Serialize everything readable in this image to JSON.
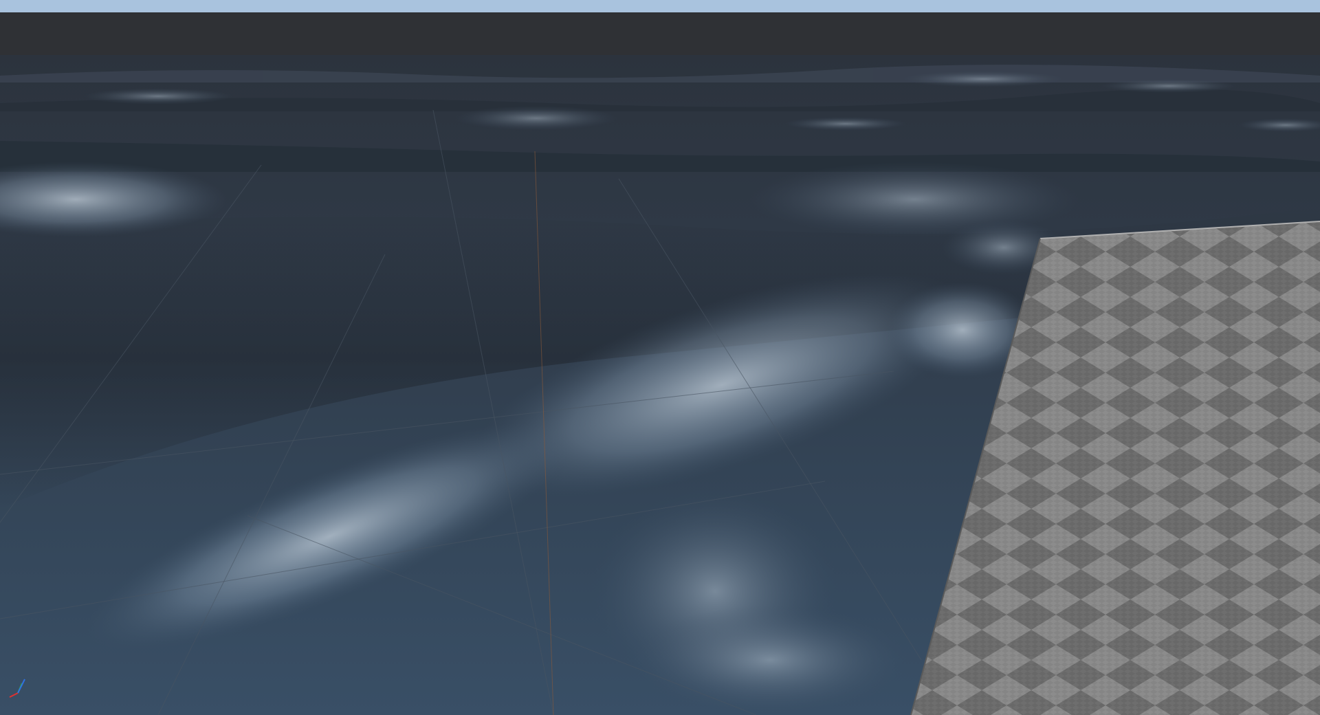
{
  "viewport": {
    "description_label": "",
    "colors": {
      "sky": "#a9c3de",
      "far_band": "#2f3135",
      "water_far": "#2c3440",
      "water_mid": "#324152",
      "water_near": "#37506a",
      "foam": "#b8c7d6",
      "grid_line": "#4a5563",
      "checker_light": "#8a8a8a",
      "checker_dark": "#6a6a6a"
    },
    "gizmo": {
      "icon": "axis-gizmo-icon",
      "axis_colors": {
        "x": "#e03030",
        "y": "#30c030",
        "z": "#3070e0"
      }
    },
    "objects": [
      {
        "name": "ocean-water-surface",
        "icon": "water-surface"
      },
      {
        "name": "checkerboard-plane",
        "icon": "checker-material"
      }
    ]
  }
}
